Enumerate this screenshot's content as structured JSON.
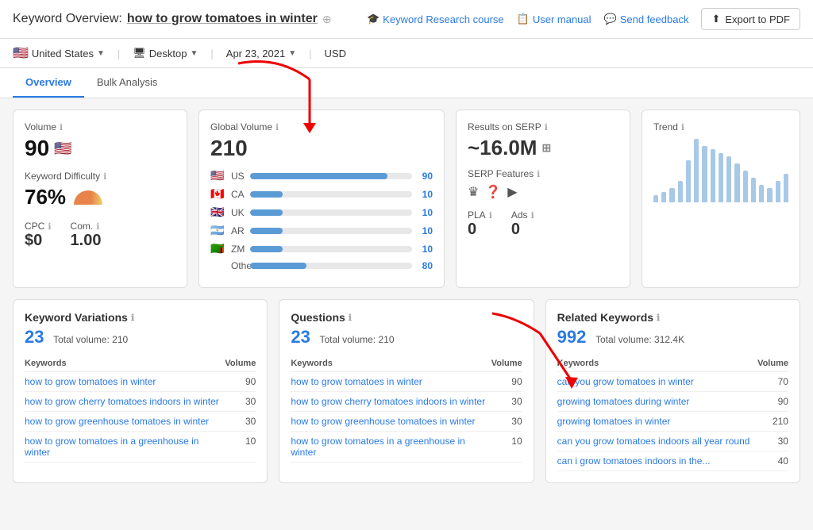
{
  "header": {
    "title_static": "Keyword Overview:",
    "keyword": "how to grow tomatoes in winter",
    "edit_icon": "✎",
    "links": [
      {
        "label": "Keyword Research course",
        "icon": "🎓"
      },
      {
        "label": "User manual",
        "icon": "📋"
      },
      {
        "label": "Send feedback",
        "icon": "💬"
      }
    ],
    "export_label": "Export to PDF"
  },
  "toolbar": {
    "country": "United States",
    "country_flag": "🇺🇸",
    "device": "Desktop",
    "device_icon": "🖥",
    "date": "Apr 23, 2021",
    "currency": "USD"
  },
  "tabs": [
    {
      "label": "Overview",
      "active": true
    },
    {
      "label": "Bulk Analysis",
      "active": false
    }
  ],
  "cards": {
    "volume": {
      "label": "Volume",
      "value": "90",
      "flag": "🇺🇸",
      "kd_label": "Keyword Difficulty",
      "kd_value": "76%",
      "cpc_label": "CPC",
      "cpc_value": "$0",
      "com_label": "Com.",
      "com_value": "1.00"
    },
    "global_volume": {
      "label": "Global Volume",
      "value": "210",
      "bars": [
        {
          "flag": "🇺🇸",
          "code": "US",
          "fill_pct": 85,
          "num": "90"
        },
        {
          "flag": "🇨🇦",
          "code": "CA",
          "fill_pct": 20,
          "num": "10"
        },
        {
          "flag": "🇬🇧",
          "code": "UK",
          "fill_pct": 20,
          "num": "10"
        },
        {
          "flag": "🇦🇷",
          "code": "AR",
          "fill_pct": 20,
          "num": "10"
        },
        {
          "flag": "🇿🇲",
          "code": "ZM",
          "fill_pct": 20,
          "num": "10"
        },
        {
          "flag": "",
          "code": "Other",
          "fill_pct": 35,
          "num": "80"
        }
      ]
    },
    "serp": {
      "label": "Results on SERP",
      "value": "~16.0M",
      "features_label": "SERP Features",
      "features_icons": [
        "♛",
        "❓",
        "▶"
      ],
      "pla_label": "PLA",
      "pla_value": "0",
      "ads_label": "Ads",
      "ads_value": "0"
    },
    "trend": {
      "label": "Trend",
      "bars": [
        10,
        15,
        20,
        30,
        60,
        90,
        80,
        75,
        70,
        65,
        55,
        45,
        35,
        25,
        20,
        30,
        40
      ]
    }
  },
  "sections": {
    "keyword_variations": {
      "title": "Keyword Variations",
      "count": "23",
      "total_label": "Total volume: 210",
      "col_keywords": "Keywords",
      "col_volume": "Volume",
      "rows": [
        {
          "keyword": "how to grow tomatoes in winter",
          "volume": "90"
        },
        {
          "keyword": "how to grow cherry tomatoes indoors in winter",
          "volume": "30"
        },
        {
          "keyword": "how to grow greenhouse tomatoes in winter",
          "volume": "30"
        },
        {
          "keyword": "how to grow tomatoes in a greenhouse in winter",
          "volume": "10"
        }
      ]
    },
    "questions": {
      "title": "Questions",
      "count": "23",
      "total_label": "Total volume: 210",
      "col_keywords": "Keywords",
      "col_volume": "Volume",
      "rows": [
        {
          "keyword": "how to grow tomatoes in winter",
          "volume": "90"
        },
        {
          "keyword": "how to grow cherry tomatoes indoors in winter",
          "volume": "30"
        },
        {
          "keyword": "how to grow greenhouse tomatoes in winter",
          "volume": "30"
        },
        {
          "keyword": "how to grow tomatoes in a greenhouse in winter",
          "volume": "10"
        }
      ]
    },
    "related_keywords": {
      "title": "Related Keywords",
      "count": "992",
      "total_label": "Total volume: 312.4K",
      "col_keywords": "Keywords",
      "col_volume": "Volume",
      "rows": [
        {
          "keyword": "can you grow tomatoes in winter",
          "volume": "70"
        },
        {
          "keyword": "growing tomatoes during winter",
          "volume": "90"
        },
        {
          "keyword": "growing tomatoes in winter",
          "volume": "210"
        },
        {
          "keyword": "can you grow tomatoes indoors all year round",
          "volume": "30"
        },
        {
          "keyword": "can i grow tomatoes indoors in the...",
          "volume": "40"
        }
      ]
    }
  },
  "colors": {
    "accent": "#2a7ae4",
    "bar_fill": "#5b9bd5",
    "trend_bar": "#a8c8e8"
  }
}
